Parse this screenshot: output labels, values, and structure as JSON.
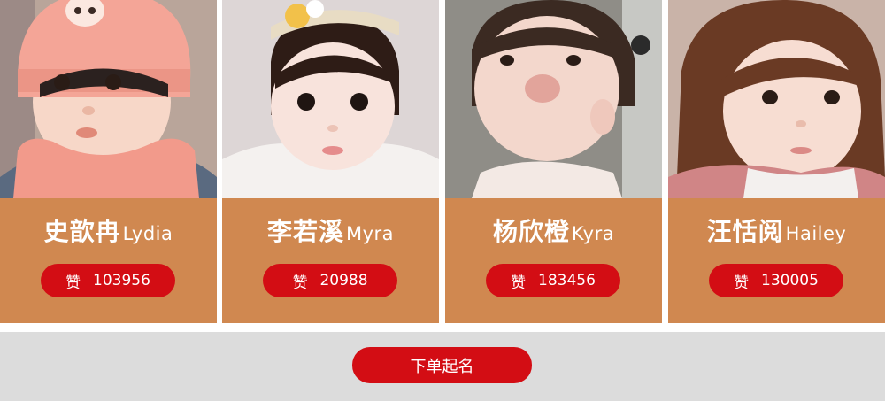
{
  "cards": [
    {
      "name_cn": "史歆冉",
      "name_en": "Lydia",
      "like_label": "赞",
      "likes": "103956"
    },
    {
      "name_cn": "李若溪",
      "name_en": "Myra",
      "like_label": "赞",
      "likes": "20988"
    },
    {
      "name_cn": "杨欣橙",
      "name_en": "Kyra",
      "like_label": "赞",
      "likes": "183456"
    },
    {
      "name_cn": "汪恬阅",
      "name_en": "Hailey",
      "like_label": "赞",
      "likes": "130005"
    }
  ],
  "footer": {
    "order_label": "下单起名"
  },
  "colors": {
    "card_bg": "#d08850",
    "button_red": "#d30d14",
    "footer_bg": "#dcdcdc"
  }
}
